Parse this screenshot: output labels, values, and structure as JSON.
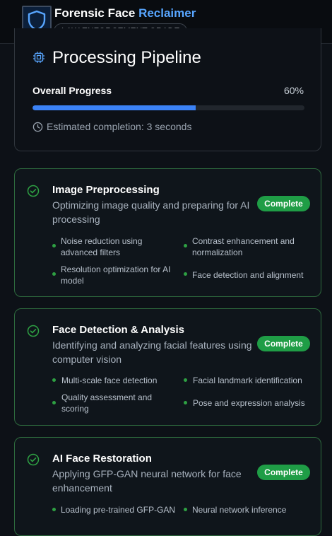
{
  "header": {
    "title_main": "Forensic Face",
    "title_accent": "Reclaimer",
    "badge": "LAW ENFORCEMENT GRADE",
    "logo_icon": "shield-icon"
  },
  "pipeline": {
    "title": "Processing Pipeline",
    "icon": "cpu-icon",
    "overall_label": "Overall Progress",
    "overall_percent_text": "60%",
    "overall_progress": 0.6,
    "eta_icon": "clock-icon",
    "eta_text": "Estimated completion: 3 seconds"
  },
  "colors": {
    "accent": "#58a6ff",
    "progress": "#3b82f6",
    "success": "#1f9d46",
    "bullet": "#2ea043"
  },
  "steps": [
    {
      "title": "Image Preprocessing",
      "description": "Optimizing image quality and preparing for AI processing",
      "status": "Complete",
      "bullets": [
        "Noise reduction using advanced filters",
        "Contrast enhancement and normalization",
        "Resolution optimization for AI model",
        "Face detection and alignment"
      ]
    },
    {
      "title": "Face Detection & Analysis",
      "description": "Identifying and analyzing facial features using computer vision",
      "status": "Complete",
      "bullets": [
        "Multi-scale face detection",
        "Facial landmark identification",
        "Quality assessment and scoring",
        "Pose and expression analysis"
      ]
    },
    {
      "title": "AI Face Restoration",
      "description": "Applying GFP-GAN neural network for face enhancement",
      "status": "Complete",
      "bullets": [
        "Loading pre-trained GFP-GAN",
        "Neural network inference"
      ]
    }
  ]
}
